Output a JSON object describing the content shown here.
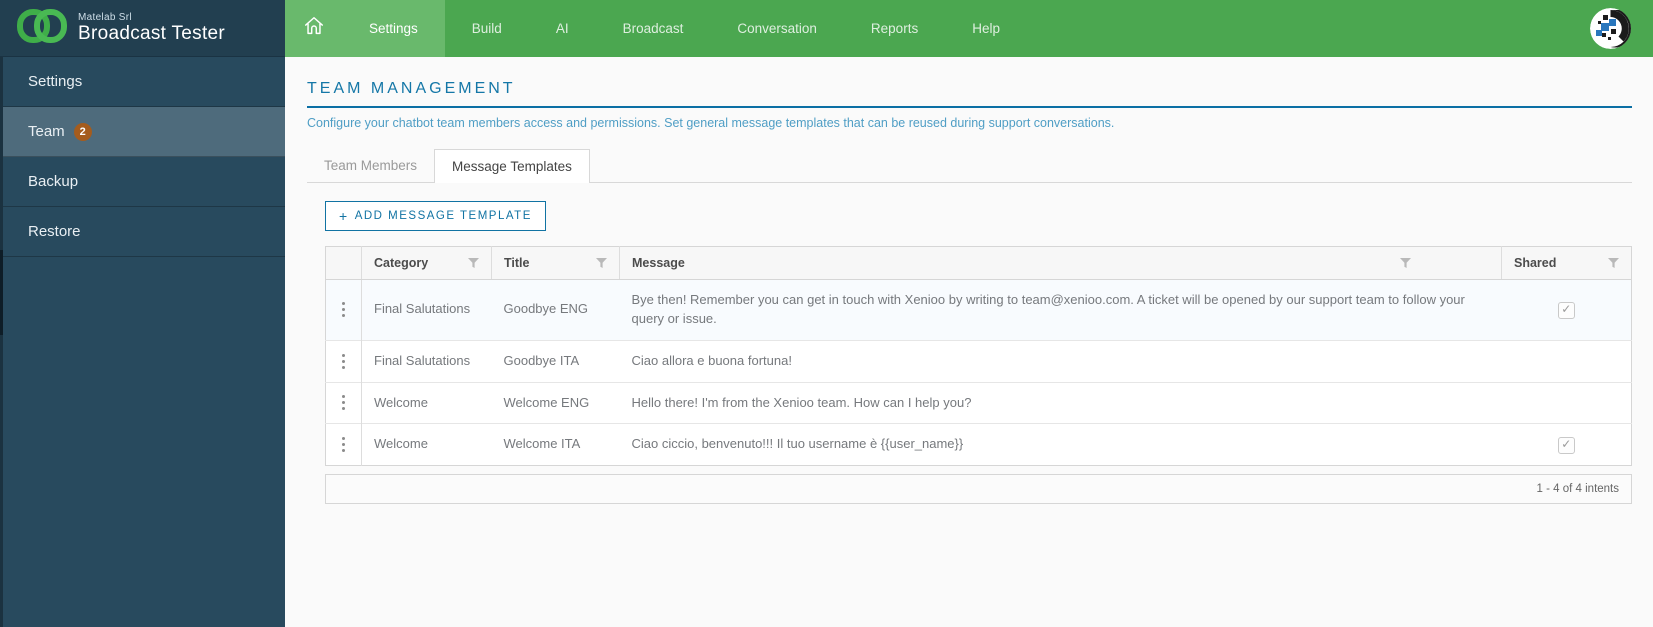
{
  "brand": {
    "company": "Matelab Srl",
    "app": "Broadcast Tester"
  },
  "topnav": {
    "items": [
      "Settings",
      "Build",
      "AI",
      "Broadcast",
      "Conversation",
      "Reports",
      "Help"
    ],
    "active": "Settings"
  },
  "sidebar": {
    "items": [
      {
        "label": "Settings"
      },
      {
        "label": "Team",
        "badge": "2",
        "active": true
      },
      {
        "label": "Backup"
      },
      {
        "label": "Restore"
      }
    ]
  },
  "page": {
    "title": "TEAM MANAGEMENT",
    "description": "Configure your chatbot team members access and permissions. Set general message templates that can be reused during support conversations."
  },
  "tabs": [
    {
      "label": "Team Members",
      "active": false
    },
    {
      "label": "Message Templates",
      "active": true
    }
  ],
  "toolbar": {
    "add_button": "ADD MESSAGE TEMPLATE",
    "add_plus": "+"
  },
  "table": {
    "columns": [
      "Category",
      "Title",
      "Message",
      "Shared"
    ],
    "rows": [
      {
        "category": "Final Salutations",
        "title": "Goodbye ENG",
        "message": "Bye then! Remember you can get in touch with Xenioo by writing to team@xenioo.com. A ticket will be opened by our support team to follow your query or issue.",
        "shared": true,
        "highlighted": true
      },
      {
        "category": "Final Salutations",
        "title": "Goodbye ITA",
        "message": "Ciao allora e buona fortuna!",
        "shared": false
      },
      {
        "category": "Welcome",
        "title": "Welcome ENG",
        "message": "Hello there! I'm from the Xenioo team. How can I help you?",
        "shared": false
      },
      {
        "category": "Welcome",
        "title": "Welcome ITA",
        "message": "Ciao ciccio, benvenuto!!! Il tuo username è {{user_name}}",
        "shared": true
      }
    ],
    "footer": "1 - 4 of 4 intents"
  },
  "colors": {
    "nav_green": "#4ba750",
    "nav_green_active": "#69b96c",
    "sidebar_bg": "#284a5e",
    "sidebar_active": "#4e6b7c",
    "accent_blue": "#1173a3",
    "badge_orange": "#a55c1d"
  }
}
